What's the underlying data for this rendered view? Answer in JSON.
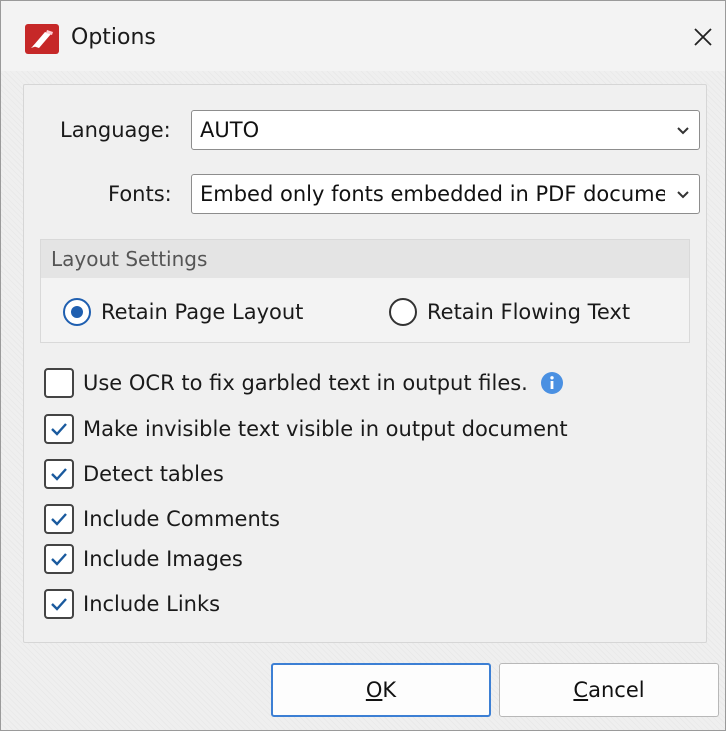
{
  "window": {
    "title": "Options",
    "app_icon": "pdf-xchange-logo-icon",
    "close_icon": "close-icon"
  },
  "fields": {
    "language_label": "Language:",
    "language_value": "AUTO",
    "fonts_label": "Fonts:",
    "fonts_value": "Embed only fonts embedded in PDF document"
  },
  "layout_settings": {
    "header": "Layout Settings",
    "options": [
      {
        "label": "Retain Page Layout",
        "selected": true
      },
      {
        "label": "Retain Flowing Text",
        "selected": false
      }
    ]
  },
  "checkboxes": [
    {
      "label": "Use OCR to fix garbled text in output files.",
      "checked": false,
      "has_info": true
    },
    {
      "label": "Make invisible text visible in output document",
      "checked": true
    },
    {
      "label": "Detect tables",
      "checked": true
    },
    {
      "label": "Include Comments",
      "checked": true
    },
    {
      "label": "Include Images",
      "checked": true
    },
    {
      "label": "Include Links",
      "checked": true
    }
  ],
  "buttons": {
    "ok": "OK",
    "cancel": "Cancel"
  },
  "colors": {
    "accent": "#1f5fb0",
    "check": "#1a5a9e",
    "info": "#4a90e2",
    "logo": "#c62828"
  }
}
